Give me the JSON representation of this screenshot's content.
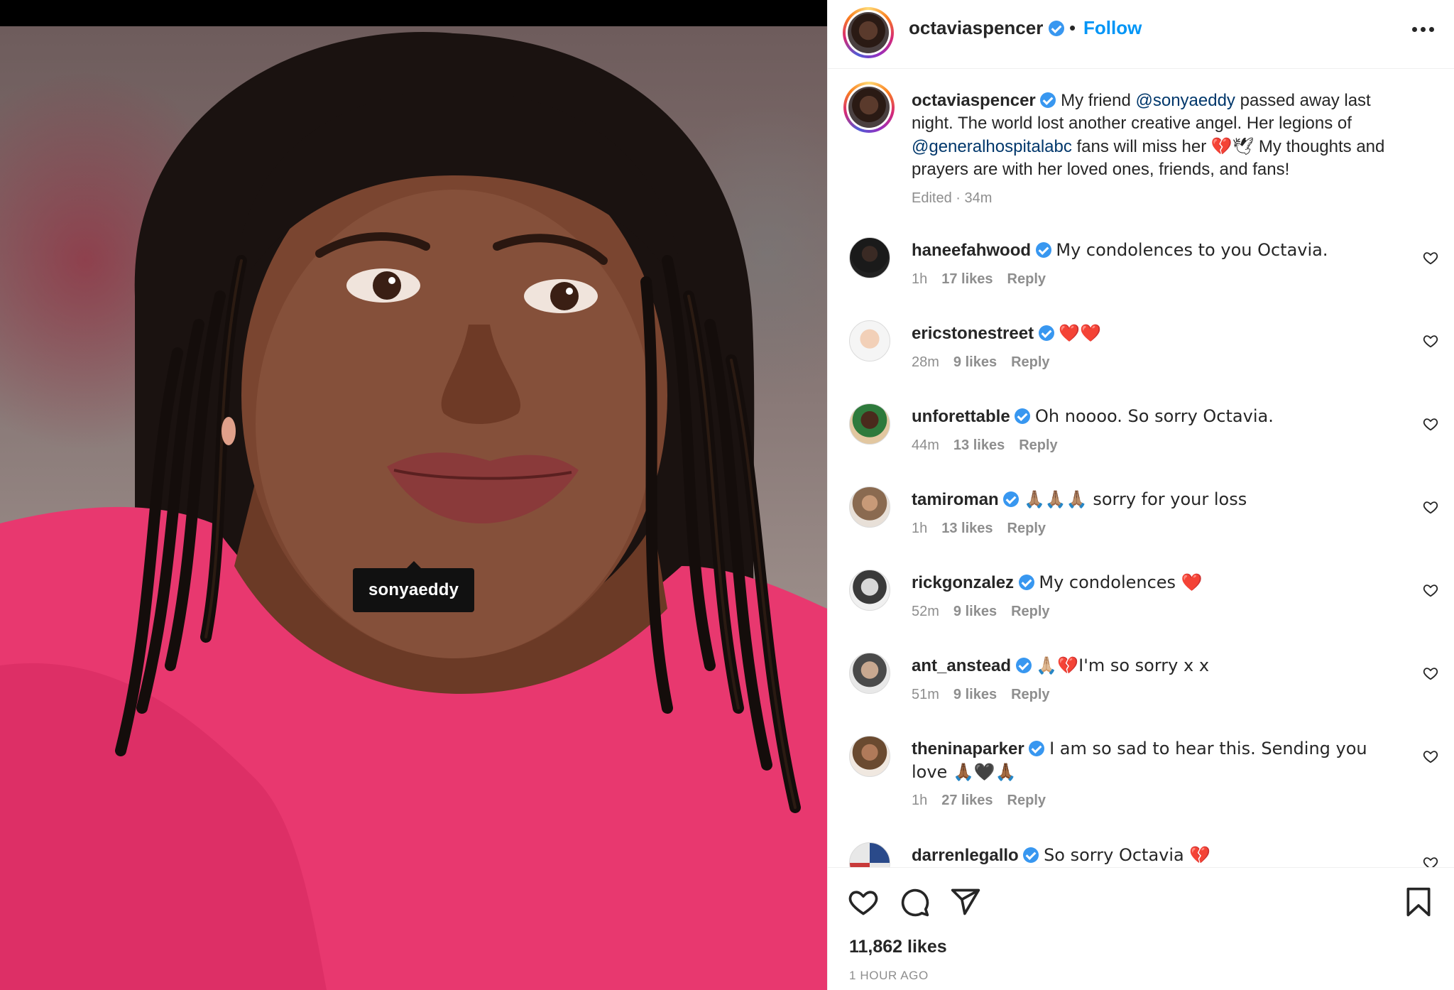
{
  "media": {
    "tag_label": "sonyaeddy"
  },
  "header": {
    "username": "octaviaspencer",
    "separator": "•",
    "follow_label": "Follow"
  },
  "caption": {
    "username": "octaviaspencer",
    "text_1": "My friend ",
    "mention_1": "@sonyaeddy",
    "text_2": " passed away last night. The world lost another creative angel. Her legions of ",
    "mention_2": "@generalhospitalabc",
    "text_3": " fans will miss her ",
    "emoji": "💔🕊",
    "text_4": " My thoughts and prayers are with her loved ones, friends, and fans!",
    "meta": "Edited · 34m"
  },
  "comments": [
    {
      "username": "haneefahwood",
      "text": "My condolences to you Octavia.",
      "time": "1h",
      "likes": "17 likes",
      "reply": "Reply"
    },
    {
      "username": "ericstonestreet",
      "text": "❤️❤️",
      "time": "28m",
      "likes": "9 likes",
      "reply": "Reply"
    },
    {
      "username": "unforettable",
      "text": "Oh noooo. So sorry Octavia.",
      "time": "44m",
      "likes": "13 likes",
      "reply": "Reply"
    },
    {
      "username": "tamiroman",
      "text": "🙏🏽🙏🏽🙏🏽 sorry for your loss",
      "time": "1h",
      "likes": "13 likes",
      "reply": "Reply"
    },
    {
      "username": "rickgonzalez",
      "text": "My condolences ❤️",
      "time": "52m",
      "likes": "9 likes",
      "reply": "Reply"
    },
    {
      "username": "ant_anstead",
      "text": "🙏🏼💔I'm so sorry x x",
      "time": "51m",
      "likes": "9 likes",
      "reply": "Reply"
    },
    {
      "username": "theninaparker",
      "text": "I am so sad to hear this. Sending you love 🙏🏾🖤🙏🏾",
      "time": "1h",
      "likes": "27 likes",
      "reply": "Reply"
    },
    {
      "username": "darrenlegallo",
      "text": "So sorry Octavia 💔",
      "time": "",
      "likes": "",
      "reply": ""
    }
  ],
  "footer": {
    "likes": "11,862 likes",
    "time_ago": "1 HOUR AGO"
  },
  "icons": {
    "like": "heart-icon",
    "comment": "comment-icon",
    "share": "share-icon",
    "save": "bookmark-icon",
    "more": "more-icon",
    "verified": "verified-icon"
  },
  "colors": {
    "follow": "#0095f6",
    "verified": "#3897f0",
    "mention": "#00376b",
    "meta": "#8e8e8e"
  }
}
